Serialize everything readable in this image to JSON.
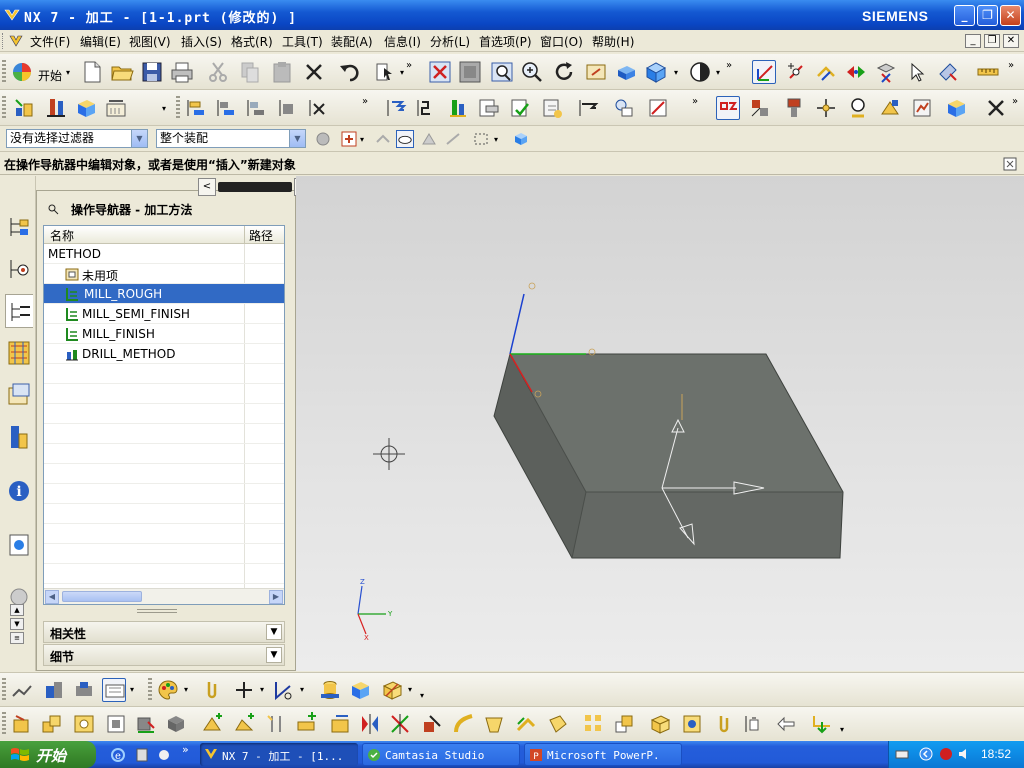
{
  "window": {
    "title": "NX 7 - 加工 - [1-1.prt (修改的) ]",
    "brand": "SIEMENS",
    "controls": {
      "minimize": "_",
      "maximize": "❐",
      "close": "✕"
    }
  },
  "menubar": {
    "items": [
      "文件(F)",
      "编辑(E)",
      "视图(V)",
      "插入(S)",
      "格式(R)",
      "工具(T)",
      "装配(A)",
      "信息(I)",
      "分析(L)",
      "首选项(P)",
      "窗口(O)",
      "帮助(H)"
    ]
  },
  "toolbar": {
    "start_label": "开始"
  },
  "filters": {
    "type_filter": "没有选择过滤器",
    "scope_filter": "整个装配"
  },
  "cue": {
    "text": "在操作导航器中编辑对象，或者是使用“插入”新建对象"
  },
  "navigator": {
    "title": "操作导航器 - 加工方法",
    "columns": {
      "name": "名称",
      "path": "路径"
    },
    "root": "METHOD",
    "items": [
      {
        "label": "未用项",
        "icon": "unused-folder-icon",
        "selected": false
      },
      {
        "label": "MILL_ROUGH",
        "icon": "mill-method-icon",
        "selected": true
      },
      {
        "label": "MILL_SEMI_FINISH",
        "icon": "mill-method-icon",
        "selected": false
      },
      {
        "label": "MILL_FINISH",
        "icon": "mill-method-icon",
        "selected": false
      },
      {
        "label": "DRILL_METHOD",
        "icon": "drill-method-icon",
        "selected": false
      }
    ],
    "sections": {
      "dependencies": "相关性",
      "details": "细节"
    }
  },
  "taskbar": {
    "start": "开始",
    "tasks": [
      {
        "label": "NX 7 - 加工 - [1...",
        "active": true
      },
      {
        "label": "Camtasia Studio",
        "active": false
      },
      {
        "label": "Microsoft PowerP.",
        "active": false
      }
    ],
    "clock": "18:52"
  },
  "colors": {
    "titlebar": "#0a46c4",
    "selection": "#316ac5",
    "part_face": "#6b706b",
    "viewport": "#e0e0e0"
  }
}
